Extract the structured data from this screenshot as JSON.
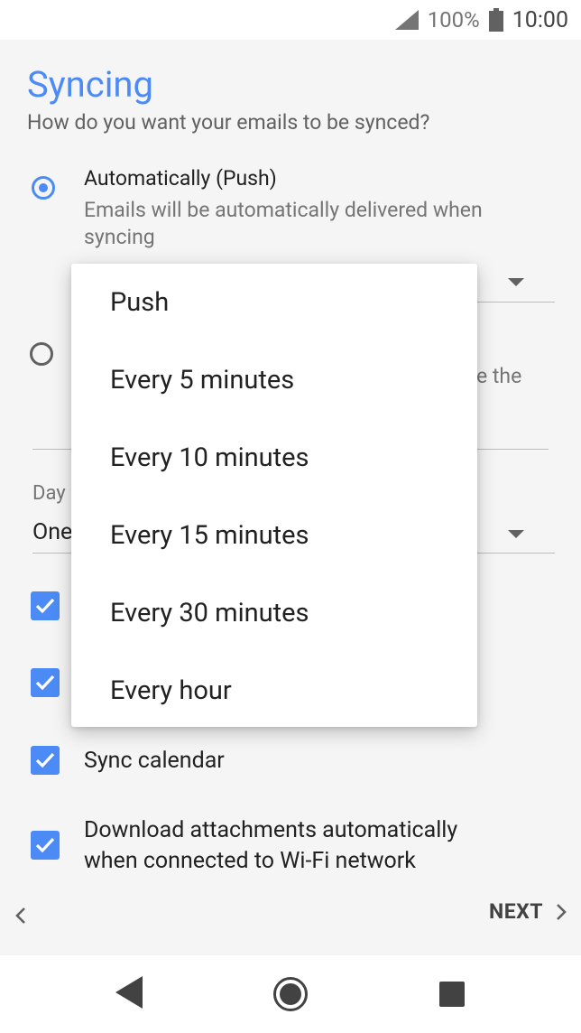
{
  "status_bar": {
    "battery_percent": "100%",
    "time": "10:00"
  },
  "page": {
    "title": "Syncing",
    "subtitle": "How do you want your emails to be synced?"
  },
  "sync_options": [
    {
      "title": "Automatically (Push)",
      "description_line1": "Emails will be automatically delivered when",
      "description_line2": "syncing",
      "selected": true
    },
    {
      "description_partial": "e the",
      "selected": false
    }
  ],
  "days_field": {
    "label_partial": "Day",
    "value_partial": "One"
  },
  "checkboxes": [
    {
      "label": "",
      "checked": true
    },
    {
      "label": "",
      "checked": true
    },
    {
      "label": "Sync calendar",
      "checked": true
    },
    {
      "label_line1": "Download attachments automatically",
      "label_line2": "when connected to Wi-Fi network",
      "checked": true
    }
  ],
  "footer": {
    "next_label": "NEXT"
  },
  "dropdown": {
    "items": [
      "Push",
      "Every 5 minutes",
      "Every 10 minutes",
      "Every 15 minutes",
      "Every 30 minutes",
      "Every hour"
    ]
  },
  "colors": {
    "accent": "#4c8bf5"
  }
}
